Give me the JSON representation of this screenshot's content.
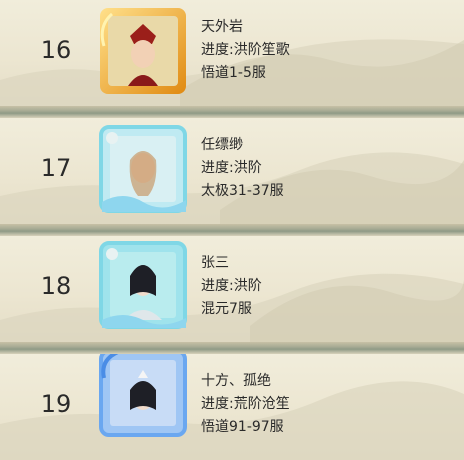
{
  "rows": [
    {
      "rank": "16",
      "name": "天外岩",
      "progress": "进度:洪阶笙歌",
      "server": "悟道1-5服",
      "frame_color": "#f1b51f"
    },
    {
      "rank": "17",
      "name": "任缥缈",
      "progress": "进度:洪阶",
      "server": "太极31-37服",
      "frame_color": "#7fd7e6"
    },
    {
      "rank": "18",
      "name": "张三",
      "progress": "进度:洪阶",
      "server": "混元7服",
      "frame_color": "#7fd7e6"
    },
    {
      "rank": "19",
      "name": "十方、孤绝",
      "progress": "进度:荒阶沧笙",
      "server": "悟道91-97服",
      "frame_color": "#6aa7f0"
    }
  ]
}
